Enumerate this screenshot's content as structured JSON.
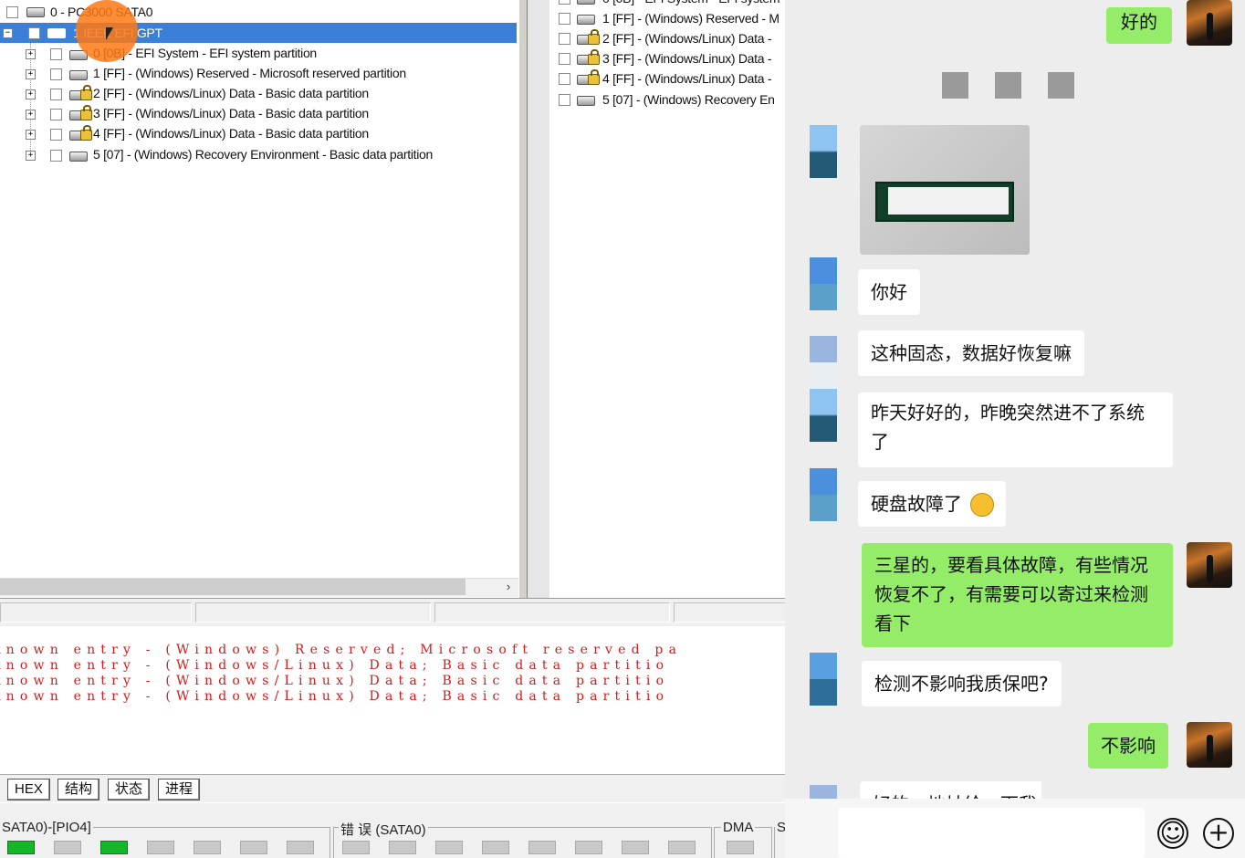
{
  "left_tree": {
    "root": "0 - PC3000 SATA0",
    "selected": "1 IEEE EFI GPT",
    "items": [
      "0 [0B] - EFI System - EFI system partition",
      "1 [FF] - (Windows) Reserved - Microsoft reserved partition",
      "2 [FF] - (Windows/Linux) Data - Basic data partition",
      "3 [FF] - (Windows/Linux) Data - Basic data partition",
      "4 [FF] - (Windows/Linux) Data - Basic data partition",
      "5 [07] - (Windows) Recovery Environment - Basic data partition"
    ]
  },
  "right_tree": {
    "items": [
      "0 [0B] - EFI System - EFI system",
      "1 [FF] - (Windows) Reserved - M",
      "2 [FF] - (Windows/Linux) Data -",
      "3 [FF] - (Windows/Linux) Data -",
      "4 [FF] - (Windows/Linux) Data -",
      "5 [07] - (Windows) Recovery En"
    ]
  },
  "log": {
    "lines": [
      "known entry - (Windows) Reserved; Microsoft reserved pa",
      "known entry - (Windows/Linux) Data; Basic data partitio",
      "known entry - (Windows/Linux) Data; Basic data partitio",
      "known entry - (Windows/Linux) Data; Basic data partitio"
    ]
  },
  "tabs": [
    "HEX",
    "结构",
    "状态",
    "进程"
  ],
  "bottom": {
    "group1": "SATA0)-[PIO4]",
    "group2": "错 误 (SATA0)",
    "group3": "DMA",
    "group4": "S"
  },
  "chat": {
    "messages": [
      {
        "from": "me",
        "text": "好的"
      },
      {
        "from": "other",
        "text": "你好"
      },
      {
        "from": "other",
        "text": "这种固态，数据好恢复嘛"
      },
      {
        "from": "other",
        "text": "昨天好好的，昨晚突然进不了系统了"
      },
      {
        "from": "other",
        "text": "硬盘故障了"
      },
      {
        "from": "me",
        "text": "三星的，要看具体故障，有些情况恢复不了，有需要可以寄过来检测看下"
      },
      {
        "from": "other",
        "text": "检测不影响我质保吧?"
      },
      {
        "from": "me",
        "text": "不影响"
      },
      {
        "from": "other",
        "text": "好的，地址给一下我"
      }
    ],
    "icons": {
      "emoji": "smiley-icon",
      "add": "plus-icon"
    }
  },
  "colors": {
    "selection": "#3b80d6",
    "log_text": "#d41a1a",
    "green_bubble": "#95ec69",
    "led_on": "#16b62a"
  }
}
